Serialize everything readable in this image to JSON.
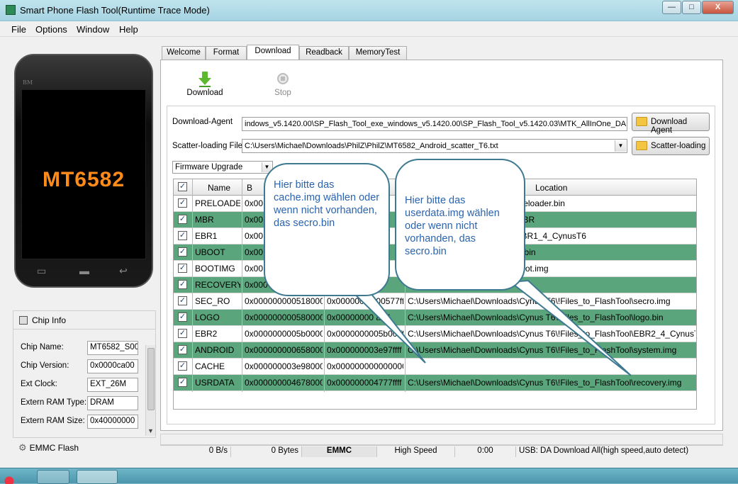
{
  "window": {
    "title": "Smart Phone Flash Tool(Runtime Trace Mode)",
    "buttons": [
      "—",
      "□",
      "X"
    ]
  },
  "menu": [
    "File",
    "Options",
    "Window",
    "Help"
  ],
  "phone": {
    "brand": "BM",
    "chip": "MT6582"
  },
  "chip_info": {
    "title": "Chip Info",
    "rows": [
      {
        "label": "Chip Name:",
        "value": "MT6582_S00"
      },
      {
        "label": "Chip Version:",
        "value": "0x0000ca00"
      },
      {
        "label": "Ext Clock:",
        "value": "EXT_26M"
      },
      {
        "label": "Extern RAM Type:",
        "value": "DRAM"
      },
      {
        "label": "Extern RAM Size:",
        "value": "0x40000000"
      }
    ]
  },
  "emmc_flash": "EMMC Flash",
  "tabs": [
    "Welcome",
    "Format",
    "Download",
    "Readback",
    "MemoryTest"
  ],
  "toolbar": {
    "download": "Download",
    "stop": "Stop"
  },
  "download_agent": {
    "label": "Download-Agent",
    "path": "indows_v5.1420.00\\SP_Flash_Tool_exe_windows_v5.1420.00\\SP_Flash_Tool_v5.1420.03\\MTK_AllInOne_DA.bin",
    "button": "Download Agent"
  },
  "scatter": {
    "label": "Scatter-loading File",
    "path": "C:\\Users\\Michael\\Downloads\\PhilZ\\PhilZ\\MT6582_Android_scatter_T6.txt",
    "button": "Scatter-loading"
  },
  "mode": "Firmware Upgrade",
  "table": {
    "headers": {
      "name": "Name",
      "begin": "B",
      "location": "Location"
    },
    "rows": [
      {
        "name": "PRELOADER",
        "begin": "0x00",
        "end": "",
        "location": "ynus T6\\!Files_to_FlashTool\\preloader.bin",
        "checked": true,
        "green": false
      },
      {
        "name": "MBR",
        "begin": "0x00",
        "end": "",
        "location": "ynus T6\\!Files_to_FlashTool\\MBR",
        "checked": true,
        "green": true
      },
      {
        "name": "EBR1",
        "begin": "0x00",
        "end": "",
        "location": "ynus T6\\!Files_to_FlashTool\\EBR1_4_CynusT6",
        "checked": true,
        "green": false
      },
      {
        "name": "UBOOT",
        "begin": "0x00",
        "end": "",
        "location": "ynus T6\\!Files_to_FlashTool\\lk.bin",
        "checked": true,
        "green": true
      },
      {
        "name": "BOOTIMG",
        "begin": "0x00",
        "end": "",
        "location": "ynus T6\\!Files_to_FlashTool\\boot.img",
        "checked": true,
        "green": false
      },
      {
        "name": "RECOVERY",
        "begin": "0x000",
        "end": "2ffff",
        "location": "PhilZ\\PhilZ\\recovery.img",
        "checked": true,
        "green": true
      },
      {
        "name": "SEC_RO",
        "begin": "0x0000000005180000",
        "end": "0x00000000 00577ffff",
        "location": "C:\\Users\\Michael\\Downloads\\Cynus T6\\!Files_to_FlashTool\\secro.img",
        "checked": true,
        "green": false
      },
      {
        "name": "LOGO",
        "begin": "0x0000000005800000",
        "end": "0x00000000 affff",
        "location": "C:\\Users\\Michael\\Downloads\\Cynus T6\\!Files_to_FlashTool\\logo.bin",
        "checked": true,
        "green": true
      },
      {
        "name": "EBR2",
        "begin": "0x0000000005b00000",
        "end": "0x0000000005b00 ff",
        "location": "C:\\Users\\Michael\\Downloads\\Cynus T6\\!Files_to_FlashTool\\EBR2_4_CynusT6",
        "checked": true,
        "green": false
      },
      {
        "name": "ANDROID",
        "begin": "0x0000000006580000",
        "end": "0x000000003e97ffff",
        "location": "C:\\Users\\Michael\\Downloads\\Cynus T6\\!Files_to_FlashTool\\system.img",
        "checked": true,
        "green": true
      },
      {
        "name": "CACHE",
        "begin": "0x000000003e980000",
        "end": "0x0000000000000000",
        "location": "",
        "checked": true,
        "green": false
      },
      {
        "name": "USRDATA",
        "begin": "0x0000000046780000",
        "end": "0x000000004777ffff",
        "location": "C:\\Users\\Michael\\Downloads\\Cynus T6\\!Files_to_FlashTool\\recovery.img",
        "checked": true,
        "green": true
      }
    ]
  },
  "callouts": [
    {
      "text": "Hier  bitte das cache.img wählen oder wenn nicht vorhanden, das secro.bin"
    },
    {
      "text": "Hier  bitte das userdata.img wählen oder wenn nicht vorhanden, das secro.bin"
    }
  ],
  "status": {
    "speed": "0 B/s",
    "bytes": "0 Bytes",
    "storage": "EMMC",
    "mode": "High Speed",
    "time": "0:00",
    "usb": "USB: DA Download All(high speed,auto detect)"
  },
  "colors": {
    "title_bar": "#a6d3e2",
    "row_green": "#5aa57c",
    "callout_text": "#2a64b0",
    "chip_text": "#ff8c1a"
  }
}
